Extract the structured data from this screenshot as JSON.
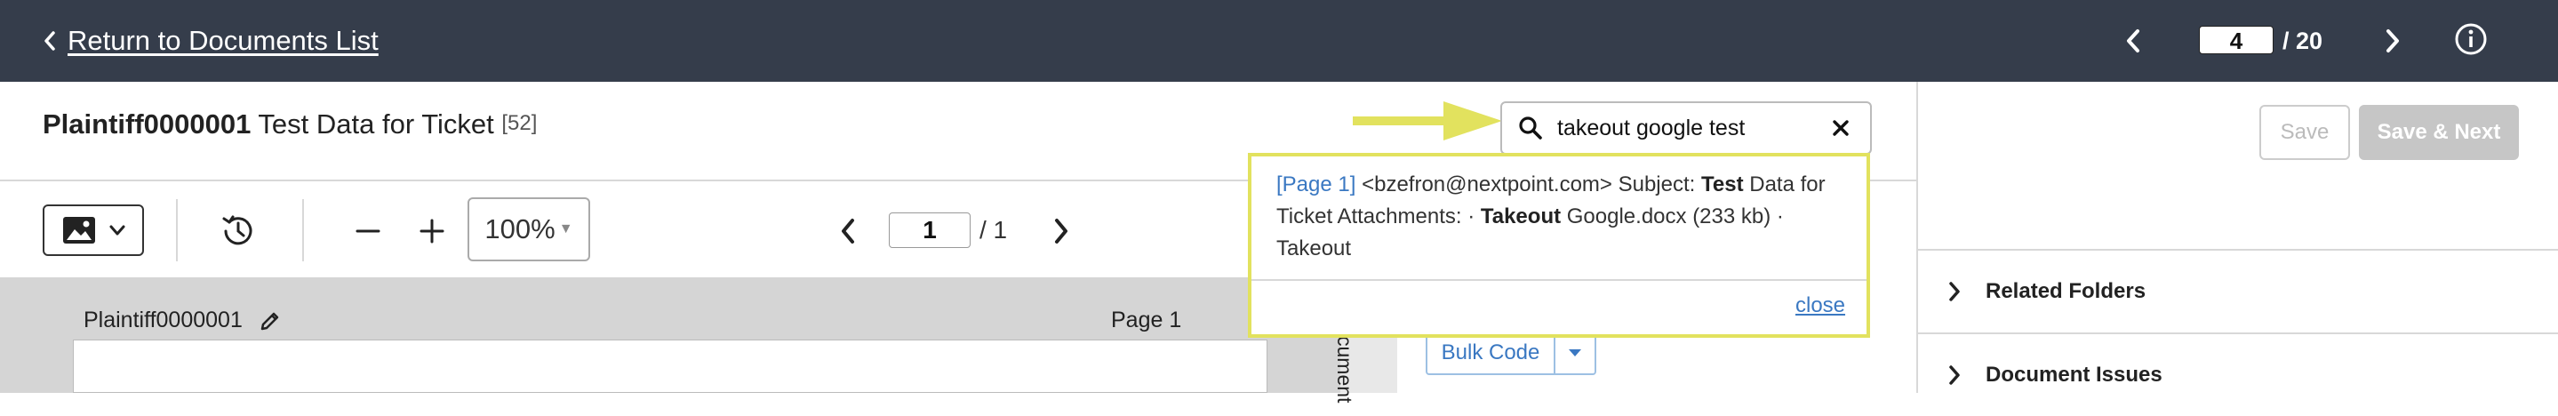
{
  "header": {
    "back_label": "Return to Documents List",
    "doc_position": "4",
    "doc_total": "/ 20"
  },
  "document": {
    "bates": "Plaintiff0000001",
    "title": "Test Data for Ticket",
    "count": "[52]"
  },
  "toolbar": {
    "zoom": "100%",
    "page_current": "1",
    "page_total": "/ 1"
  },
  "viewer": {
    "doc_name": "Plaintiff0000001",
    "page_label": "Page 1",
    "side_tab_text": "cument"
  },
  "search": {
    "query": "takeout google test",
    "result": {
      "page": "[Page 1]",
      "part1": "<bzefron@nextpoint.com> Subject:",
      "hl1": "Test",
      "part2": "Data for Ticket Attachments: ·",
      "hl2": "Takeout",
      "part3": "Google.docx (233 kb) · Takeout"
    },
    "close_label": "close"
  },
  "coding": {
    "bulk_code_label": "Bulk Code"
  },
  "right_panel": {
    "save_label": "Save",
    "save_next_label": "Save & Next",
    "sections": [
      {
        "label": "Related Folders"
      },
      {
        "label": "Document Issues"
      }
    ]
  },
  "colors": {
    "topbar": "#353d4b",
    "highlight": "#e2e25e",
    "link": "#3a78c2"
  },
  "icons": [
    "chevron-left-icon",
    "chevron-right-icon",
    "info-icon",
    "image-icon",
    "caret-down-icon",
    "history-icon",
    "minus-icon",
    "plus-icon",
    "pencil-icon",
    "search-icon",
    "close-icon",
    "arrow-right-icon"
  ]
}
